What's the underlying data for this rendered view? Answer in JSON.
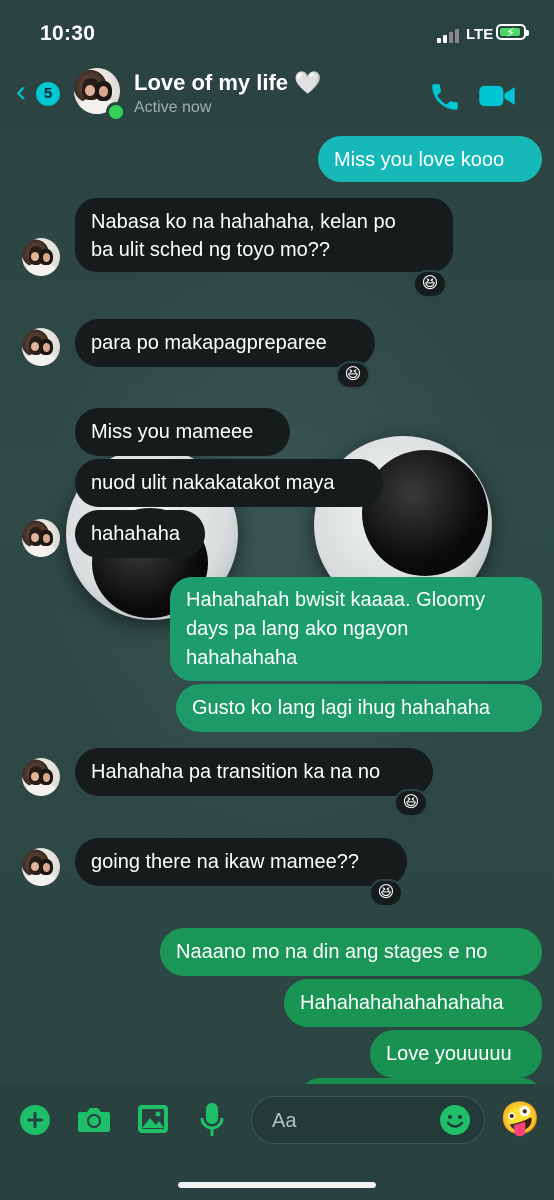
{
  "status_bar": {
    "time": "10:30",
    "network": "LTE"
  },
  "header": {
    "back_count": "5",
    "contact_name": "Love of my life 🤍",
    "presence": "Active now",
    "icons": [
      "back-chevron-icon",
      "phone-icon",
      "video-camera-icon"
    ]
  },
  "colors": {
    "accent": "#00c6d6",
    "incoming_bubble": "#161c1c",
    "outgoing_teal": "#14b8b8",
    "outgoing_green": "#1f9a5a"
  },
  "messages": [
    {
      "dir": "out",
      "text": "Miss you love kooo"
    },
    {
      "dir": "in",
      "lines": [
        "Nabasa ko na hahahaha, kelan po",
        "ba ulit sched ng toyo mo??"
      ],
      "reaction": "😆"
    },
    {
      "dir": "in",
      "text": "para po makapagpreparee",
      "reaction": "😆"
    },
    {
      "dir": "in",
      "text": "Miss you mameee"
    },
    {
      "dir": "in",
      "text": "nuod ulit nakakatakot maya"
    },
    {
      "dir": "in",
      "text": "hahahaha"
    },
    {
      "dir": "out",
      "lines": [
        "Hahahahah bwisit kaaaa. Gloomy",
        "days pa lang ako ngayon",
        "hahahahaha"
      ]
    },
    {
      "dir": "out",
      "text": "Gusto ko lang lagi ihug hahahaha"
    },
    {
      "dir": "in",
      "text": "Hahahaha pa transition ka na no",
      "reaction": "😆"
    },
    {
      "dir": "in",
      "text": "going there na ikaw mamee??",
      "reaction": "😆"
    },
    {
      "dir": "out",
      "text": "Naaano mo na din ang stages e no"
    },
    {
      "dir": "out",
      "text": "Hahahahahahahahaha"
    },
    {
      "dir": "out",
      "text": "Love youuuuu"
    }
  ],
  "composer": {
    "placeholder": "Aa",
    "icons": [
      "plus-icon",
      "camera-icon",
      "image-icon",
      "microphone-icon",
      "emoji-icon"
    ],
    "quick_reaction": "🤪"
  }
}
